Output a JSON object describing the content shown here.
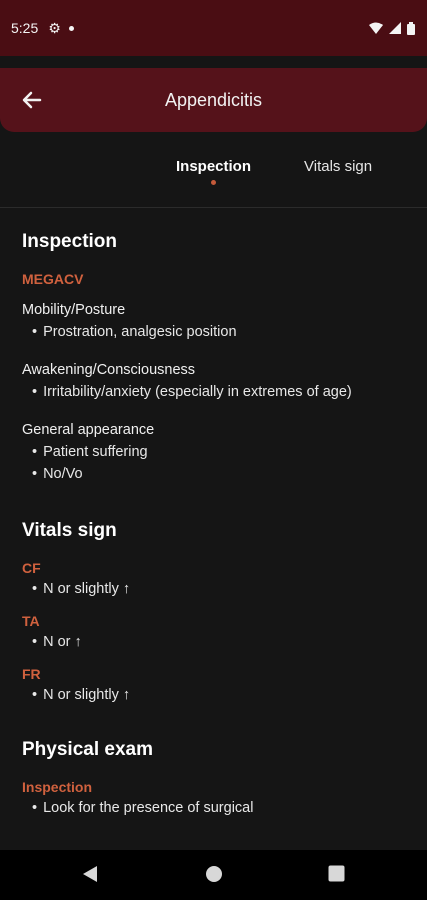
{
  "status": {
    "time": "5:25"
  },
  "app_bar": {
    "title": "Appendicitis"
  },
  "tabs": [
    {
      "label": "Inspection"
    },
    {
      "label": "Vitals sign"
    }
  ],
  "sections": {
    "inspection": {
      "title": "Inspection",
      "mnemonic": "MEGACV",
      "groups": [
        {
          "title": "Mobility/Posture",
          "bullets": [
            "Prostration, analgesic position"
          ]
        },
        {
          "title": "Awakening/Consciousness",
          "bullets": [
            "Irritability/anxiety (especially in extremes of age)"
          ]
        },
        {
          "title": "General appearance",
          "bullets": [
            "Patient suffering",
            "No/Vo"
          ]
        }
      ]
    },
    "vitals": {
      "title": "Vitals sign",
      "items": [
        {
          "label": "CF",
          "bullet": "N or slightly ↑"
        },
        {
          "label": "TA",
          "bullet": "N or ↑"
        },
        {
          "label": "FR",
          "bullet": "N or slightly ↑"
        }
      ]
    },
    "physical": {
      "title": "Physical exam",
      "sub": "Inspection",
      "bullet": "Look for the presence of surgical"
    }
  },
  "colors": {
    "accent": "#d0613e",
    "status_bar": "#4a0d13",
    "app_bar": "#55121a",
    "background": "#151515"
  }
}
